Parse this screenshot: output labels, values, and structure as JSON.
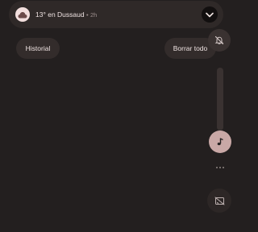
{
  "notification": {
    "icon": "cloud-icon",
    "title": "13° en Dussaud",
    "separator": "•",
    "time": "2h",
    "expand_icon": "chevron-down-icon"
  },
  "chips": {
    "history_label": "Historial",
    "clear_all_label": "Borrar todo"
  },
  "volume_panel": {
    "ringer_icon": "bell-off-icon",
    "media_icon": "music-note-icon",
    "more_icon": "more-horizontal-icon",
    "cast_icon": "cast-off-icon",
    "media_level": 0
  },
  "colors": {
    "background": "#231f1f",
    "card": "#2f2928",
    "accent": "#c9a8a6"
  }
}
